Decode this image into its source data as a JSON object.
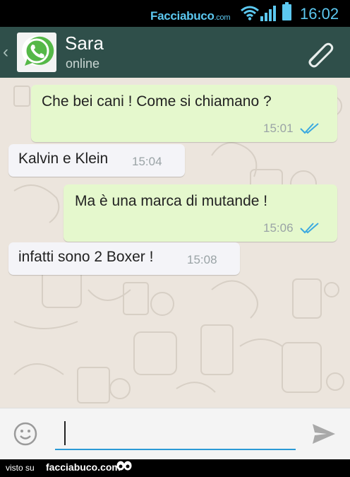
{
  "status_bar": {
    "brand_name": "Facciabuco",
    "brand_tld": ".com",
    "time": "16:02",
    "accent_color": "#5cc8f0"
  },
  "header": {
    "back_icon": "chevron-left",
    "app_icon": "whatsapp-logo",
    "contact_name": "Sara",
    "contact_status": "online",
    "attach_icon": "paperclip",
    "color": "#2f4f4a"
  },
  "messages": [
    {
      "direction": "outgoing",
      "text": "Che bei cani ! Come si chiamano ?",
      "time": "15:01",
      "status": "read-double-tick"
    },
    {
      "direction": "incoming",
      "text": "Kalvin e Klein",
      "time": "15:04"
    },
    {
      "direction": "outgoing",
      "text": "Ma è una marca di mutande !",
      "time": "15:06",
      "status": "read-double-tick"
    },
    {
      "direction": "incoming",
      "text": "infatti sono 2 Boxer !",
      "time": "15:08"
    }
  ],
  "input_bar": {
    "emoji_icon": "smiley",
    "message_value": "",
    "send_icon": "paper-plane",
    "underline_color": "#2b9ad6"
  },
  "footer": {
    "visto_label": "visto su",
    "site": "facciabuco.com"
  }
}
